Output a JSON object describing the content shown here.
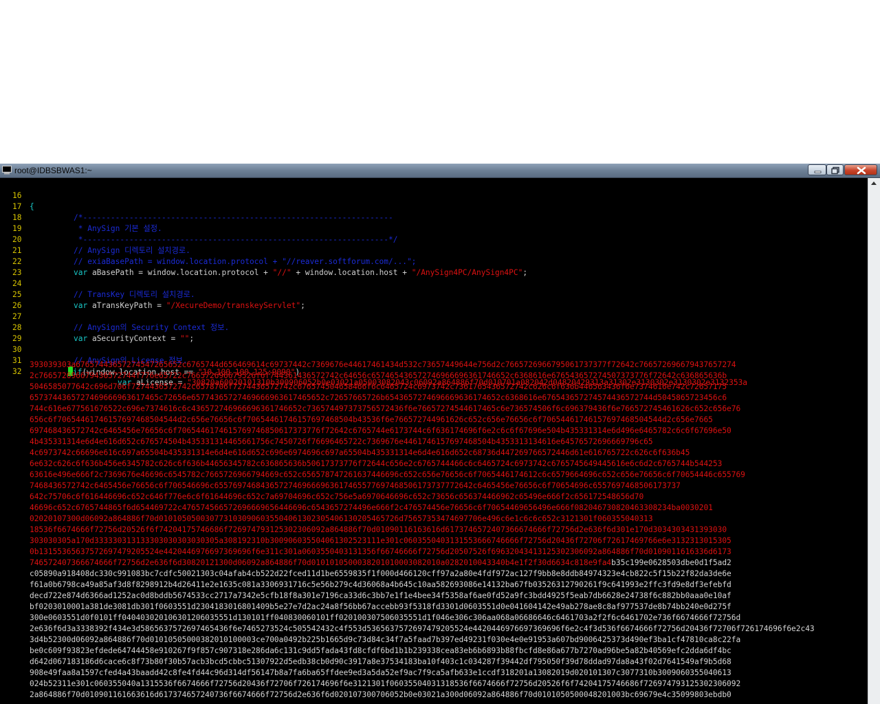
{
  "window": {
    "title": "root@IDBSBWAS1:~",
    "icon": "putty-terminal-icon",
    "minimize_icon": "minimize-icon",
    "maximize_icon": "maximize-icon",
    "close_icon": "close-icon"
  },
  "colors": {
    "background": "#000000",
    "line_number": "#d6c300",
    "comment": "#1b2bd6",
    "keyword": "#19c7c7",
    "string": "#dd1111",
    "cursor": "#22dd22",
    "titlebar": "#6f8298"
  },
  "lines": [
    {
      "num": "16",
      "text": "{"
    },
    {
      "num": "17",
      "text": "/*-------------------------------------------------------------------"
    },
    {
      "num": "18",
      "text": " * AnySign 기본 설정."
    },
    {
      "num": "19",
      "text": " *------------------------------------------------------------------*/"
    },
    {
      "num": "20",
      "text": "// AnySign 디렉토리 설치경로."
    },
    {
      "num": "21",
      "text": "// exiaBasePath = window.location.protocol + \"//reaver.softforum.com/...\";"
    },
    {
      "num": "22",
      "kw": "var",
      "a": " aBasePath = window.location.protocol + ",
      "s1": "\"//\"",
      "b": " + window.location.host + ",
      "s2": "\"/AnySign4PC/AnySign4PC\"",
      "c": ";"
    },
    {
      "num": "23",
      "text": ""
    },
    {
      "num": "24",
      "text": "// TransKey 디렉토리 설치경로."
    },
    {
      "num": "25",
      "kw": "var",
      "a": " aTransKeyPath = ",
      "s1": "\"/XecureDemo/transkeyServlet\"",
      "c": ";"
    },
    {
      "num": "26",
      "text": ""
    },
    {
      "num": "27",
      "text": "// AnySign의 Security Context 정보."
    },
    {
      "num": "28",
      "kw": "var",
      "a": " aSecurityContext = ",
      "s1": "\"\"",
      "c": ";"
    },
    {
      "num": "29",
      "text": ""
    },
    {
      "num": "30",
      "text": "// AnySign의 License 정보."
    },
    {
      "num": "31",
      "kw": "if",
      "a": "(window.location.host == ",
      "s1": "\"10.100.100.125:9090\"",
      "c": ")"
    },
    {
      "num": "32",
      "kw": "var",
      "a": " aLicense = ",
      "s1": "\"30820a60020101310b300906052b0e03021a05003082043c06092a864886f70d010701a082042d04820429313a31302e3130302e3130302e3132353a"
    }
  ],
  "license_red": [
    "393039303a67657443657274547265652c6765744d656469614c69737442c7369676e44617461434d532c73657449644e756d2c7665726966795061737377f72642c766572696679437657274",
    "2c766572696679436572744f776e65722c766572696679526f6f744361436572742c64656c657465436572746966696361746652c6368616e676543657274507373776f72642c636865636b",
    "5046585077642c696d706f7274436572742c6578706f7274436572742c676574504658466f6c6465724c6973742c7361765436572742c626c6f636b446563436f6e7374616e742c72657175",
    "6573744365727469666963617465c72656e65774365727469666963617465652c72657665726b6543657274696669636174652c6368616e676543657274574436572744d5045865723456c6",
    "744c616e677561676522c696e7374616c6c436572746966696361746652c736574497373756572436f6e76657274544617465c6e736574506f6c696379436f6e766572745461626c652c656e76",
    "656c6f70654461746157697468504544d2c656e76656c6f70654461746157697468504b43536f6e766572744961626c652c656e76656c6f70654461746157697468504544d2c656e7665",
    "697468436572742c6465456e76656c6f7065446174615769746850617373776f72642c6765744e6173744c6f636174696f6e2c6c6f67696e504b435331314e6d496e6465782c6c6f67696e50",
    "4b435331314e6d4e616d652c676574504b435331314465661756c7450726f76696465722c7369676e4461746157697468504b4353313134616e64576572696669796c65",
    "4c6973742c66696e616c697a65504b435331314e6d4e616d652c696e6974696c697a65504b435331314e6d4e616d652c68736d447269766572446d61e616765722c626c6f636b45",
    "6e632c626c6f636b456e6345782c626c6f636b44656345782c636865636b50617373776f72644c656e2c6765744466c6c6465724c6973742c6765745649445616e6c6d2c6765744b544253",
    "63616e496e666f2c7369676e46696c6545782c7665726966794669c652c656578747261637446696c652c656e76656c6f7065446174612c6c6579664696c652c656e76656c6f70654446c655769",
    "7468436572742c6465456e76656c6f706546696c65576974684365727469666963617465577697468506173737772642c6465456e76656c6f70654696c6557697468506173737",
    "642c75706c6f616446696c652c646f776e6c6f61644696c652c7a69704696c652c756e5a6970646696c652c73656c656374466962c65496e666f2c656172548656d70",
    "46696c652c6765744865f6d654469722c476574566572696669656446696c6543657274496e666f2c476574456e76656c6f70654469656496e666f082046730820463308234ba0030201",
    "02020107300d06092a864886f70d0101050500307731030906035504061302305406130205465726d75657353474697706e496c6e1c6c6c652c3121301f060355040313",
    "18536f6674666f72756d20526f6f74204175746686f726974793125302306092a864886f70d01090116163616d6173746572407366674666f72756d2e636f6d301e170d3034303431393030",
    "303030305a170d333330313133303030303030305a308192310b300906035504061302523111e301c0603550403131553666746666f72756d20436f72706f72617469766e6e3132313015305",
    "0b13155365637572697479205524e4420446976697369696f6e311c301a0603550403131356f66746666f72756d20507526f69632043413125302306092a864886f70d0109011616336d6173",
    "746572407366674666f72756d2e636f6d30820121300d06092a864886f70d0101010500038201010003082010a0282010043340b4e1f2f30d6634c818e9fa4"
  ],
  "license_tail_white": "b35c199e0628503dbe0d1f5ad2",
  "license_white": [
    "c05890a918408dc330c991083bc7cdfc50021303c04afab4cb522d22fced11d1be6559835f1f000d466120cff97a2a80e4fdf972ac127f9bb8e8ddb84974323e4cb822c5f15b22f82da3de6e",
    "f61a0b6798ca49a85af3d8f8298912b4d26411e2e1635c081a3306931716c5e56b279c4d36068a4b645c10aa582693086e14132ba67fb03526312790261f9c641993e2ffc3fd9e8df3efebfd",
    "decd722e874d6366ad1252ac0d8bddb5674533cc2717a7342e5cfb18f8a301e7196ca33d6c3bb7e1f1e4bee34f5358af6ae0fd52a9fc3bdd4925f5eab7db6628e24738f6c882bb0aaa0e10af",
    "bf0203010001a381de3081db301f0603551d2304183016801409b5e27e7d2ac24a8f56bb67accebb93f5318fd3301d0603551d0e041604142e49ab278ae8c8af977537de8b74bb240e0d275f",
    "300e0603551d0f0101ff040403020106301206035551d130101ff040830060101ff020100307506035551d1f046e306c306aa068a06686646c6461703a2f2f6c6461702e736f6674666f72756d",
    "2e636f6d3a3338392f434e3d5865637572697465436f6e7465273524c505542432c4f553d5365637572697479205524e4420446976697369696f6e2c4f3d536f6674666f72756d20436f72706f726174696f6e2c43",
    "3d4b52300d06092a864886f70d01010505000382010100003ce700a0492b225b1665d9c73d84c34f7a5faad7b397ed49231f030e4e0e91953a607bd9006425373d490ef3ba1cf47810ca8c22fa",
    "be0c609f93823efdede64744458e910267f9f857c907318e286da6c131c9dd5fada43fd8cfdf6bd1b1b239338cea83eb6b6893b88fbcfd8e86a677b7270ad96be5a82b40569efc2dda6df4bc",
    "d642d067183186d6cace6c8f73b80f30b57acb3bcd5cbbc51307922d5edb38cb0d90c3917a8e37534183ba10f403c1c034287f39442df795050f39d78ddad97da8a43f02d7641549af9b5d68",
    "908e49faa8a1597cfed4a43baadd42c8fe4fd44c96d314df56147b8a7fa6ba65ffdee9ed3a5da52ef9ac7f9ca5afb633e1ccdf318201a13082019d020101307c3077310b3009060355040613",
    "024b52311e301c060355040a1315536f6674666f72756d20436f72706f726174696f6e3121301f06035504031318536f6674666f72756d20526f6f74204175746686f726974793125302306092",
    "2a864886f70d010901161663616d617374657240736f6674666f72756d2e636f6d020107300706052b0e03021a300d06092a864886f70d0101050500048201003bc69679e4c35099803ebdb0"
  ]
}
